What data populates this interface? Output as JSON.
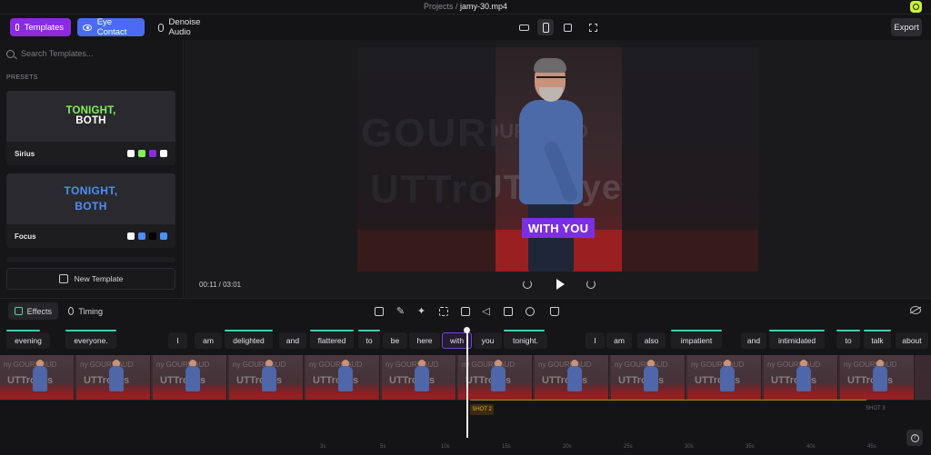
{
  "header": {
    "crumb_root": "Projects",
    "crumb_sep": "/",
    "file_name": "jamy-30.mp4"
  },
  "toolbar": {
    "templates_label": "Templates",
    "eye_contact_label": "Eye Contact",
    "denoise_label": "Denoise Audio",
    "export_label": "Export",
    "aspect_selected": "portrait"
  },
  "left_panel": {
    "search_placeholder": "Search Templates...",
    "presets_label": "PRESETS",
    "presets": [
      {
        "name": "Sirius",
        "preview_line1": "TONIGHT,",
        "preview_line2": "BOTH",
        "swatches": [
          "#ffffff",
          "#7ff25a",
          "#8a2be2",
          "#ffffff"
        ]
      },
      {
        "name": "Focus",
        "preview_line1": "TONIGHT,",
        "preview_line2": "BOTH",
        "swatches": [
          "#ffffff",
          "#4f8ef7",
          "#000000",
          "#4f8ef7"
        ]
      }
    ],
    "new_template_label": "New Template"
  },
  "preview": {
    "caption": "WITH YOU",
    "timecode": "00:11 / 03:01",
    "background_text_1": "GOURMAUD",
    "background_text_2": "UTTroyes"
  },
  "effects_bar": {
    "effects_tab": "Effects",
    "timing_tab": "Timing"
  },
  "words": [
    "evening",
    "everyone.",
    "I",
    "am",
    "delighted",
    "and",
    "flattered",
    "to",
    "be",
    "here",
    "with",
    "you",
    "tonight.",
    "I",
    "am",
    "also",
    "impatient",
    "and",
    "intimidated",
    "to",
    "talk",
    "about"
  ],
  "active_word": "with",
  "film_text": {
    "t1": "ny GOURMAUD",
    "t2": "UTTroyes"
  },
  "shots": {
    "shot2": "SHOT 2",
    "shot3": "SHOT 3"
  },
  "ruler_ticks": [
    "3s",
    "5s",
    "10s",
    "15s",
    "20s",
    "25s",
    "30s",
    "35s",
    "40s",
    "45s"
  ],
  "colors": {
    "accent_purple": "#8a2be2",
    "accent_blue": "#4a6cf2",
    "caption_bg": "#7c2fe0"
  }
}
